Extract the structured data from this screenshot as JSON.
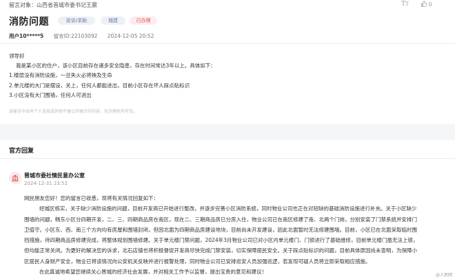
{
  "header": {
    "target_label": "留言对象：",
    "target": "山西省晋城市委书记王震",
    "like_count": "0"
  },
  "post": {
    "title": "消防问题",
    "tags": [
      "投诉/求助",
      "城建",
      "已办理"
    ],
    "user": "用户10*****5",
    "message_id": "留言ID:22103092",
    "datetime": "2024-12-05 20:52",
    "lines": [
      "领导好",
      "我是某小区的住户，该小区目前存在诸多安全隐患，存在时间常达3年以上。具体如下：",
      "1.楼层没有消防设施，一旦失火必将殃及生命",
      "2.单元楼的大门是摆设，关上，任何人都能进出，目前小区存在坏人踩点贴标识",
      "3.小区没有大门围墙，任何人可进出"
    ],
    "disclaimer": "该留言中含有个人信息或其他不便公开展示的内容，仅办理机构可见。"
  },
  "reply": {
    "section_title": "官方回复",
    "org": "晋城市委社情民意办公室",
    "datetime": "2024-12-31 23:52",
    "lines": [
      "网民朋友您好！您的留言已收悉，现将有关情况回复如下：",
      "经城区核实，关于缺少消防设施的问题，目前开发商已开始进行整改，并逐步完善小区消防系统，同时物业公司也正在对短缺的基础消防设施进行补充。关于小区缺少",
      "围墙的问题，畅东小区分四期开发，二、三、四期商品房在南区，现在二、三期商品房已分房入住，物业公司已在南区修建了南、北两个门岗，分别安装了门禁系统并安排门",
      "卫值守。小区东、西、南三个方向均有房屋和围墙封闭，但因北面为四期商品房建设地块，目前尚未开发建设，因此北面暂时无法修建围墙。目前，小区已在北面采取临时围",
      "挡措施，待四期商品房修建完成，将整体规划围墙修建。关于单元楼门禁问题，2024年3月物业公司已对小区内单元楼门、门锁进行了基础维修，目前单元楼门虽无法上锁，",
      "但均能正常关闭。为更好的解决您的诉求，北石店镇也将积极督促开发商尽快完成门禁安装，切实保障居民安全。关于踩点贴标识的问题，目前具体原因尚未查明，为保障小",
      "区居民人身财产安全，物业已将该情况向公安机关反映并进行报警处理，同时物业公司已安排巡安人员加强巡逻，若发现可疑人员将立即采取相应措施。",
      "在此真诚地希望您继续关心晋城的经济社会发展，并对相关工作予以监督，提出宝贵的意见和建议！"
    ]
  },
  "watermark": "@人民网"
}
